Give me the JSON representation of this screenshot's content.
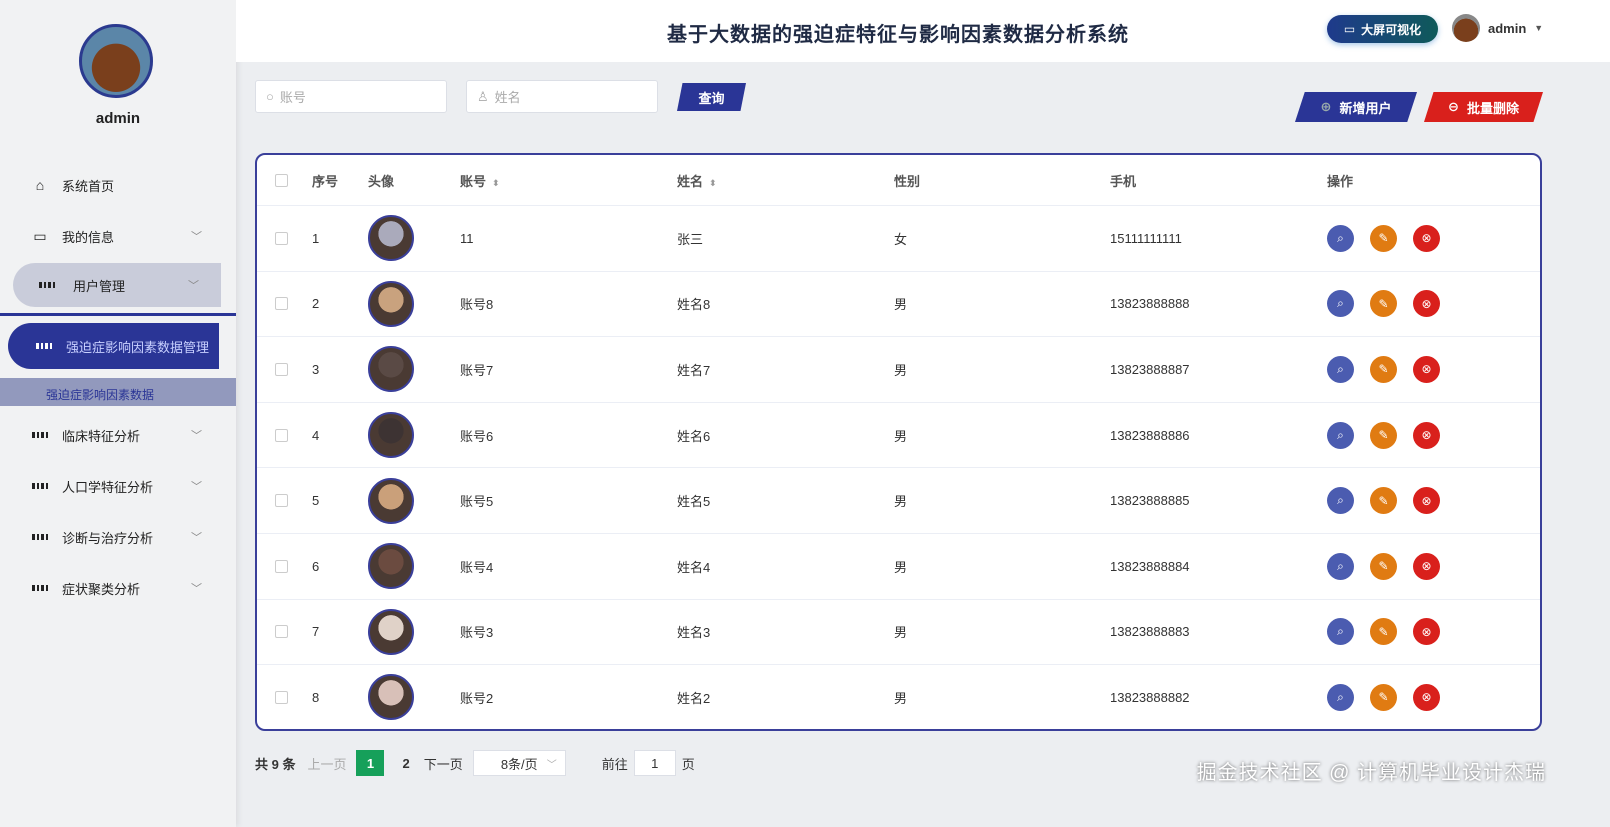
{
  "title": "基于大数据的强迫症特征与影响因素数据分析系统",
  "header": {
    "bigscreen": "大屏可视化",
    "user": "admin"
  },
  "sidebar": {
    "user": "admin",
    "items": [
      {
        "label": "系统首页",
        "icon": "home-icon"
      },
      {
        "label": "我的信息",
        "icon": "wallet-icon"
      },
      {
        "label": "用户管理",
        "icon": "grid-icon"
      },
      {
        "label": "强迫症影响因素数据管理",
        "icon": "grid-icon"
      },
      {
        "label": "临床特征分析",
        "icon": "grid-icon"
      },
      {
        "label": "人口学特征分析",
        "icon": "grid-icon"
      },
      {
        "label": "诊断与治疗分析",
        "icon": "grid-icon"
      },
      {
        "label": "症状聚类分析",
        "icon": "grid-icon"
      }
    ],
    "sub_item": "强迫症影响因素数据"
  },
  "search": {
    "account_placeholder": "账号",
    "name_placeholder": "姓名",
    "query": "查询"
  },
  "actions": {
    "add": "新增用户",
    "batch_delete": "批量删除"
  },
  "table": {
    "headers": [
      "序号",
      "头像",
      "账号",
      "姓名",
      "性别",
      "手机",
      "操作"
    ],
    "rows": [
      [
        "1",
        "11",
        "张三",
        "女",
        "15111111111"
      ],
      [
        "2",
        "账号8",
        "姓名8",
        "男",
        "13823888888"
      ],
      [
        "3",
        "账号7",
        "姓名7",
        "男",
        "13823888887"
      ],
      [
        "4",
        "账号6",
        "姓名6",
        "男",
        "13823888886"
      ],
      [
        "5",
        "账号5",
        "姓名5",
        "男",
        "13823888885"
      ],
      [
        "6",
        "账号4",
        "姓名4",
        "男",
        "13823888884"
      ],
      [
        "7",
        "账号3",
        "姓名3",
        "男",
        "13823888883"
      ],
      [
        "8",
        "账号2",
        "姓名2",
        "男",
        "13823888882"
      ]
    ]
  },
  "pager": {
    "total": "共 9 条",
    "prev": "上一页",
    "pages": [
      "1",
      "2"
    ],
    "next": "下一页",
    "size": "8条/页",
    "goto": "前往",
    "goto_value": "1",
    "page_suffix": "页"
  },
  "watermark": "掘金技术社区 @ 计算机毕业设计杰瑞",
  "colors": {
    "primary": "#2a3596",
    "danger": "#d9201c",
    "view": "#4b5cb0",
    "edit": "#e07b12",
    "success": "#16a05a"
  }
}
